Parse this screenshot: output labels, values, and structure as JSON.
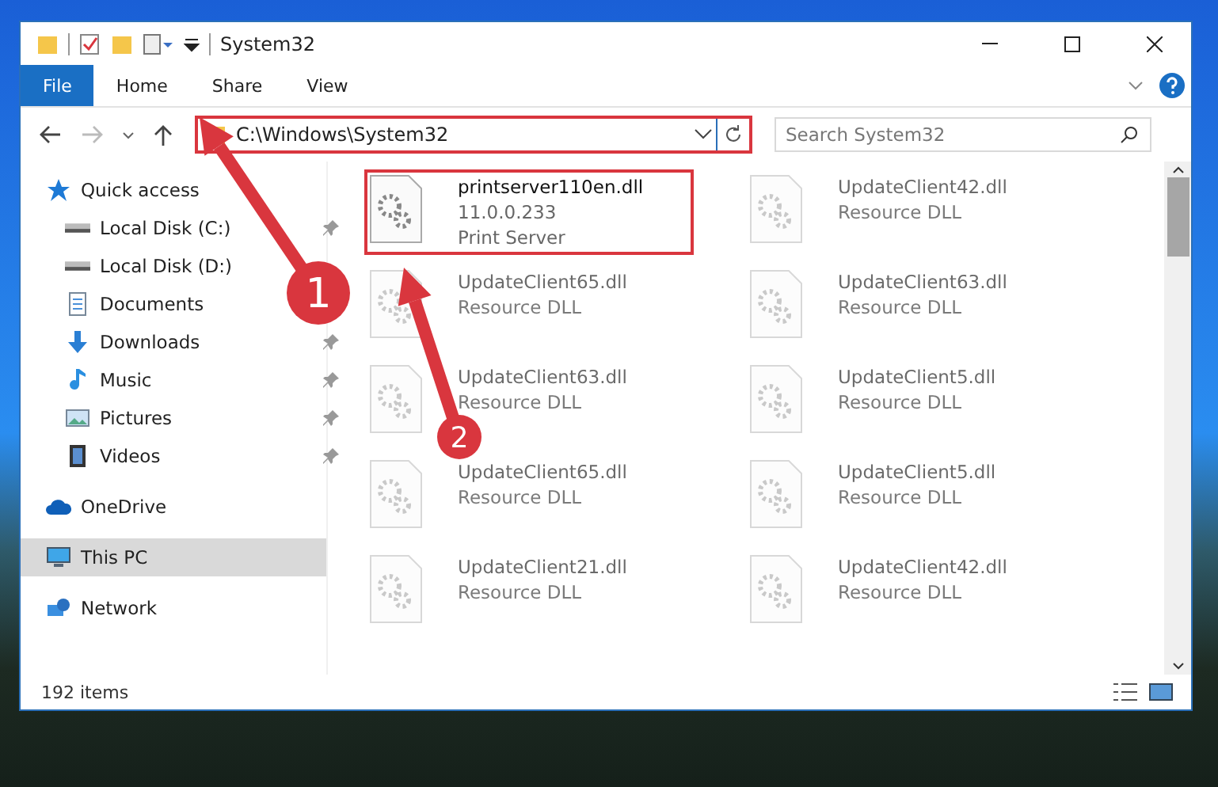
{
  "window": {
    "title": "System32"
  },
  "ribbon": {
    "tabs": [
      {
        "label": "File",
        "selected": true
      },
      {
        "label": "Home",
        "selected": false
      },
      {
        "label": "Share",
        "selected": false
      },
      {
        "label": "View",
        "selected": false
      }
    ]
  },
  "address": {
    "path": "C:\\Windows\\System32",
    "search_placeholder": "Search System32"
  },
  "sidebar": {
    "items": [
      {
        "label": "Quick access",
        "kind": "star",
        "selected": false,
        "children": [
          {
            "label": "Local Disk (C:)",
            "kind": "drive",
            "pinned": true,
            "selected": false
          },
          {
            "label": "Local Disk (D:)",
            "kind": "drive",
            "pinned": false,
            "selected": false
          },
          {
            "label": "Documents",
            "kind": "document",
            "pinned": false,
            "selected": false
          },
          {
            "label": "Downloads",
            "kind": "download",
            "pinned": true,
            "selected": false
          },
          {
            "label": "Music",
            "kind": "music",
            "pinned": true,
            "selected": false
          },
          {
            "label": "Pictures",
            "kind": "picture",
            "pinned": true,
            "selected": false
          },
          {
            "label": "Videos",
            "kind": "video",
            "pinned": true,
            "selected": false
          }
        ]
      },
      {
        "label": "OneDrive",
        "kind": "cloud",
        "selected": false
      },
      {
        "label": "This PC",
        "kind": "pc",
        "selected": true
      },
      {
        "label": "Network",
        "kind": "network",
        "selected": false
      }
    ]
  },
  "files": [
    {
      "name": "printserver110en.dll",
      "version": "11.0.0.233",
      "description": "Print Server",
      "blurred": false,
      "highlighted": true
    },
    {
      "name": "UpdateClient42.dll",
      "description": "Resource DLL",
      "blurred": true,
      "highlighted": false
    },
    {
      "name": "UpdateClient65.dll",
      "description": "Resource DLL",
      "blurred": true,
      "highlighted": false
    },
    {
      "name": "UpdateClient63.dll",
      "description": "Resource DLL",
      "blurred": true,
      "highlighted": false
    },
    {
      "name": "UpdateClient63.dll",
      "description": "Resource DLL",
      "blurred": true,
      "highlighted": false
    },
    {
      "name": "UpdateClient5.dll",
      "description": "Resource DLL",
      "blurred": true,
      "highlighted": false
    },
    {
      "name": "UpdateClient65.dll",
      "description": "Resource DLL",
      "blurred": true,
      "highlighted": false
    },
    {
      "name": "UpdateClient5.dll",
      "description": "Resource DLL",
      "blurred": true,
      "highlighted": false
    },
    {
      "name": "UpdateClient21.dll",
      "description": "Resource DLL",
      "blurred": true,
      "highlighted": false
    },
    {
      "name": "UpdateClient42.dll",
      "description": "Resource DLL",
      "blurred": true,
      "highlighted": false
    }
  ],
  "status_bar": {
    "count": "192 items"
  },
  "annotations": [
    {
      "number": "1"
    },
    {
      "number": "2"
    }
  ]
}
